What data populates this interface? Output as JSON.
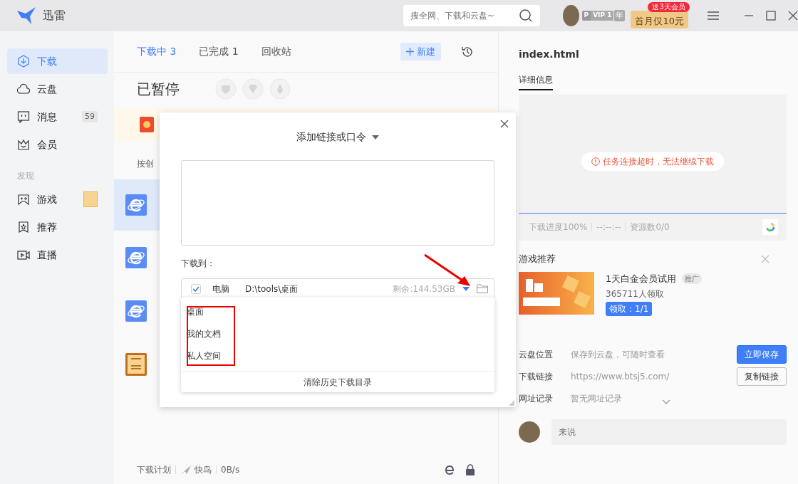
{
  "app": {
    "name": "迅雷"
  },
  "search": {
    "placeholder": "搜全网、下载和云盘~"
  },
  "account": {
    "p_mark": "P",
    "vip": "VIP 1",
    "year": "年",
    "promo": "首月仅10元",
    "promo_bubble": "送3天会员"
  },
  "sidebar": {
    "items": [
      {
        "kind": "download",
        "label": "下载",
        "selected": true
      },
      {
        "kind": "cloud",
        "label": "云盘",
        "selected": false
      },
      {
        "kind": "message",
        "label": "消息",
        "selected": false,
        "badge": "59"
      },
      {
        "kind": "member",
        "label": "会员",
        "selected": false
      }
    ],
    "section": "发现",
    "discover": [
      {
        "kind": "game",
        "label": "游戏",
        "selected": false
      },
      {
        "kind": "recommend",
        "label": "推荐",
        "selected": false
      },
      {
        "kind": "live",
        "label": "直播",
        "selected": false
      }
    ]
  },
  "tabs": [
    {
      "label": "下载中 3",
      "selected": true
    },
    {
      "label": "已完成 1",
      "selected": false
    },
    {
      "label": "回收站",
      "selected": false
    }
  ],
  "new_button": "新建",
  "status_title": "已暂停",
  "list": {
    "sort_label": "按创",
    "rows": [
      {
        "kind": "ie",
        "selected": true
      },
      {
        "kind": "ie",
        "selected": false
      },
      {
        "kind": "ie",
        "selected": false
      },
      {
        "kind": "vip",
        "selected": false
      }
    ]
  },
  "footer": {
    "plan": "下载计划",
    "accelerator": "快鸟",
    "speed": "0B/s"
  },
  "dialog": {
    "title": "添加链接或口令",
    "save_to": "下载到：",
    "destination": {
      "checked": true,
      "device": "电脑",
      "path": "D:\\tools\\桌面",
      "free": "剩余:144.53GB"
    },
    "options": [
      "桌面",
      "我的文档",
      "私人空间"
    ],
    "clear": "清除历史下载目录"
  },
  "detail": {
    "title": "index.html",
    "tab": "详细信息",
    "error": "任务连接超时，无法继续下载",
    "progress": {
      "level": 1,
      "label": "下载进度100%",
      "time": "--:--:--",
      "sources": "资源数0/0"
    },
    "game": {
      "heading": "游戏推荐",
      "name": "1天白金会员试用",
      "tag": "推广",
      "count": "365711人领取",
      "claim": "领取：1/1"
    },
    "rows": [
      {
        "label": "云盘位置",
        "value": "保存到云盘，可随时查看",
        "button": "立即保存",
        "kind": "primary"
      },
      {
        "label": "下载链接",
        "value": "https://www.btsj5.com/",
        "button": "复制链接",
        "kind": "outline"
      },
      {
        "label": "网址记录",
        "value": "暂无网址记录",
        "kind": "expand"
      }
    ],
    "comment": {
      "placeholder": "来说"
    }
  }
}
